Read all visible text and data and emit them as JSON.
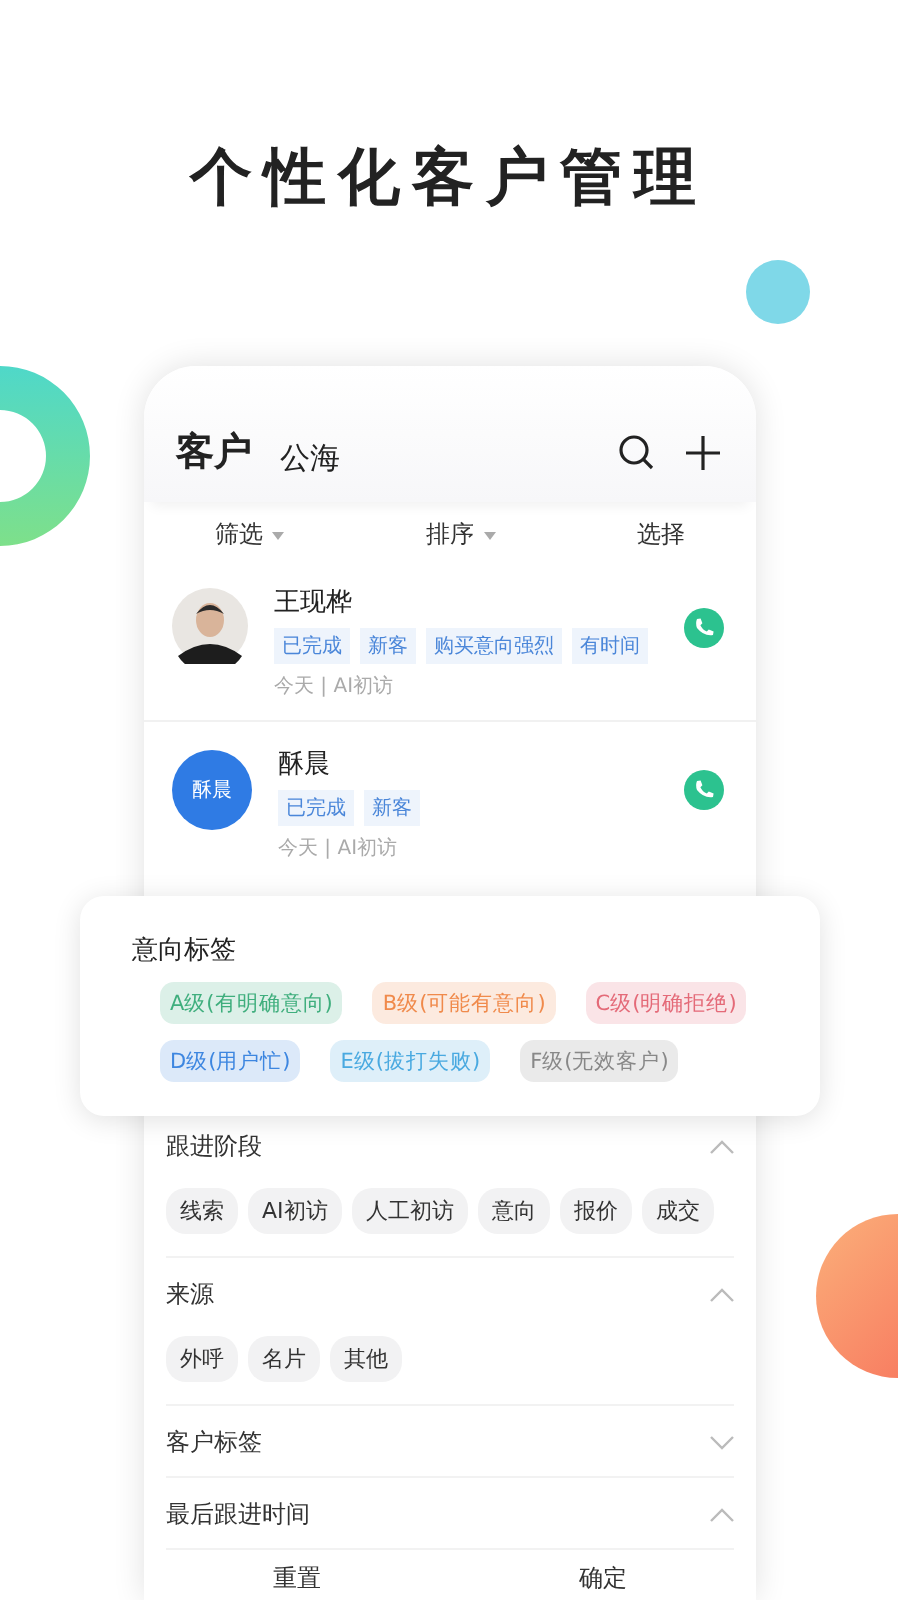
{
  "headline": "个性化客户管理",
  "app": {
    "title": "客户",
    "tab": "公海"
  },
  "toolbar": [
    {
      "label": "筛选",
      "dropdown": true
    },
    {
      "label": "排序",
      "dropdown": true
    },
    {
      "label": "选择",
      "dropdown": false
    }
  ],
  "customers": [
    {
      "name": "王现桦",
      "tags": [
        "已完成",
        "新客",
        "购买意向强烈",
        "有时间"
      ],
      "meta": "今天 | AI初访"
    },
    {
      "name": "酥晨",
      "avatar": {
        "kind": "initials",
        "text": "酥晨"
      },
      "tags": [
        "已完成",
        "新客"
      ],
      "meta": "今天 | AI初访"
    }
  ],
  "intent_panel": {
    "title": "意向标签",
    "tags": [
      {
        "label": "A级(有明确意向)",
        "color": "#3fae7d"
      },
      {
        "label": "B级(可能有意向)",
        "color": "#f08a4b"
      },
      {
        "label": "C级(明确拒绝)",
        "color": "#e46a78"
      },
      {
        "label": "D级(用户忙)",
        "color": "#3d86e0"
      },
      {
        "label": "E级(拔打失败)",
        "color": "#49a9e0"
      },
      {
        "label": "F级(无效客户)",
        "color": "#888888"
      }
    ]
  },
  "filters": [
    {
      "title": "跟进阶段",
      "expanded": true,
      "options": [
        "线索",
        "AI初访",
        "人工初访",
        "意向",
        "报价",
        "成交"
      ]
    },
    {
      "title": "来源",
      "expanded": true,
      "options": [
        "外呼",
        "名片",
        "其他"
      ]
    },
    {
      "title": "客户标签",
      "expanded": false
    },
    {
      "title": "最后跟进时间",
      "expanded": true
    }
  ],
  "buttons": [
    "重置",
    "确定"
  ]
}
